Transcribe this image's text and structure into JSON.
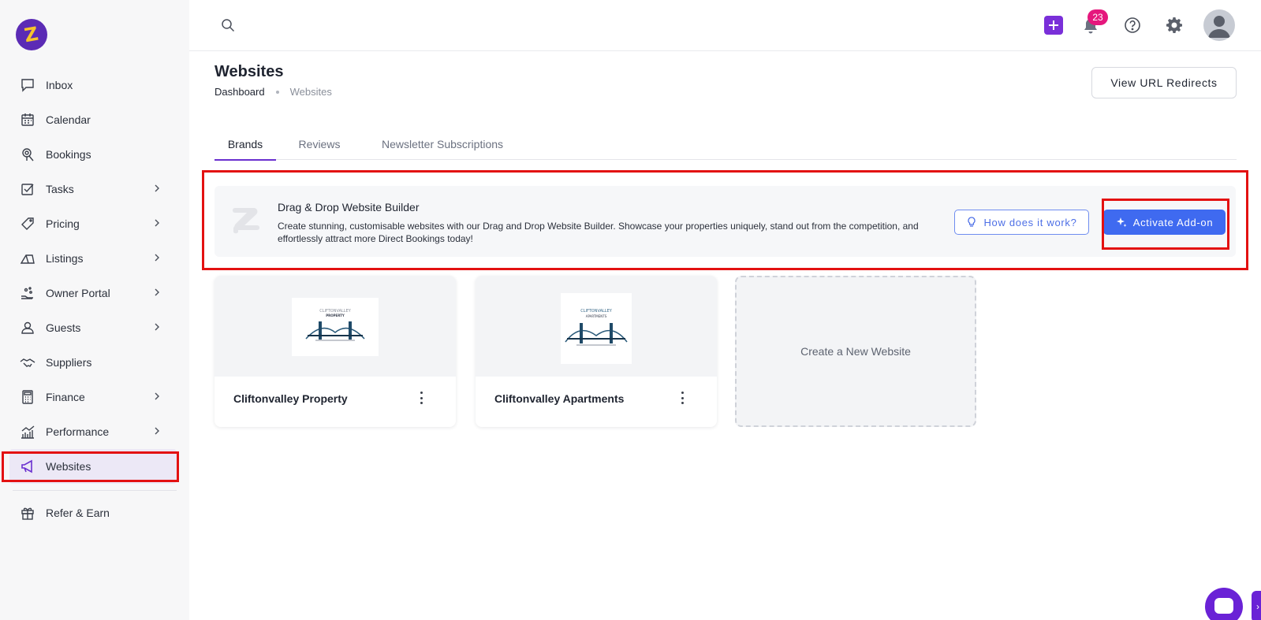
{
  "app": {
    "logo_alt": "Zeevou"
  },
  "sidebar": {
    "items": [
      {
        "label": "Inbox",
        "icon": "inbox-icon",
        "has_submenu": false
      },
      {
        "label": "Calendar",
        "icon": "calendar-icon",
        "has_submenu": false
      },
      {
        "label": "Bookings",
        "icon": "bookings-icon",
        "has_submenu": false
      },
      {
        "label": "Tasks",
        "icon": "tasks-icon",
        "has_submenu": true
      },
      {
        "label": "Pricing",
        "icon": "tag-icon",
        "has_submenu": true
      },
      {
        "label": "Listings",
        "icon": "home-icon",
        "has_submenu": true
      },
      {
        "label": "Owner Portal",
        "icon": "owner-portal-icon",
        "has_submenu": true
      },
      {
        "label": "Guests",
        "icon": "user-icon",
        "has_submenu": true
      },
      {
        "label": "Suppliers",
        "icon": "handshake-icon",
        "has_submenu": false
      },
      {
        "label": "Finance",
        "icon": "calculator-icon",
        "has_submenu": true
      },
      {
        "label": "Performance",
        "icon": "chart-icon",
        "has_submenu": true
      },
      {
        "label": "Websites",
        "icon": "megaphone-icon",
        "has_submenu": false,
        "active": true
      },
      {
        "label": "Refer & Earn",
        "icon": "gift-icon",
        "has_submenu": false
      }
    ]
  },
  "topbar": {
    "notifications_count": "23"
  },
  "page": {
    "title": "Websites",
    "breadcrumb": [
      "Dashboard",
      "Websites"
    ],
    "url_redirects_label": "View URL Redirects"
  },
  "tabs": [
    {
      "label": "Brands",
      "active": true
    },
    {
      "label": "Reviews",
      "active": false
    },
    {
      "label": "Newsletter Subscriptions",
      "active": false
    }
  ],
  "banner": {
    "title": "Drag & Drop Website Builder",
    "description": "Create stunning, customisable websites with our Drag and Drop Website Builder. Showcase your properties uniquely, stand out from the competition, and effortlessly attract more Direct Bookings today!",
    "how_label": "How does it work?",
    "activate_label": "Activate Add-on"
  },
  "websites": [
    {
      "name": "Cliftonvalley Property",
      "logo_line1": "CLIFTONVALLEY",
      "logo_line2": "PROPERTY"
    },
    {
      "name": "Cliftonvalley Apartments",
      "logo_line1": "CLIFTONVALLEY",
      "logo_line2": "APARTMENTS"
    }
  ],
  "new_website_label": "Create a New Website",
  "colors": {
    "brand_purple": "#6a2fcf",
    "activate_blue": "#3f6af0",
    "highlight_red": "#e31111",
    "badge_pink": "#e5177d"
  }
}
